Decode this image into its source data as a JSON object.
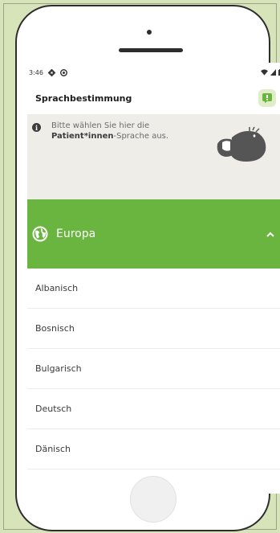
{
  "status_bar": {
    "time": "3:46",
    "icons_left": [
      "gear-icon",
      "at-icon"
    ],
    "icons_right": [
      "wifi-icon",
      "signal-icon",
      "battery-icon"
    ]
  },
  "app_bar": {
    "title": "Sprachbestimmung",
    "action_icon": "speech-bubble-icon"
  },
  "info": {
    "text_line1": "Bitte wählen Sie hier die",
    "text_bold": "Patient*innen",
    "text_rest": "-Sprache aus."
  },
  "section": {
    "title": "Europa",
    "icon": "globe-icon",
    "state_icon": "chevron-up-icon",
    "color": "#6ab53f"
  },
  "languages": [
    "Albanisch",
    "Bosnisch",
    "Bulgarisch",
    "Deutsch",
    "Dänisch"
  ]
}
